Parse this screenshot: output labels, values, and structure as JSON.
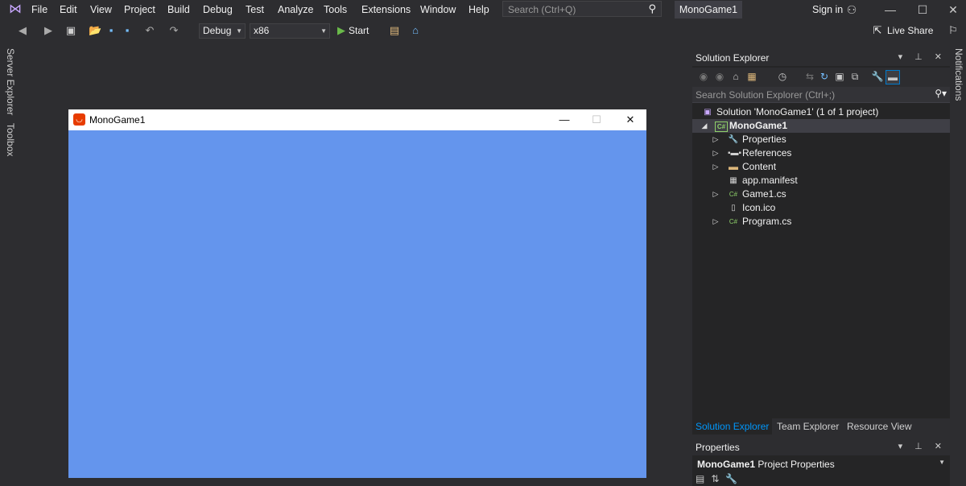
{
  "menu": [
    "File",
    "Edit",
    "View",
    "Project",
    "Build",
    "Debug",
    "Test",
    "Analyze",
    "Tools",
    "Extensions",
    "Window",
    "Help"
  ],
  "search": {
    "placeholder": "Search (Ctrl+Q)"
  },
  "solution_title": "MonoGame1",
  "sign_in": "Sign in",
  "live_share": "Live Share",
  "toolbar": {
    "configuration": "Debug",
    "platform": "x86",
    "start": "Start"
  },
  "side_tabs": {
    "server_explorer": "Server Explorer",
    "toolbox": "Toolbox",
    "notifications": "Notifications"
  },
  "game_window": {
    "title": "MonoGame1",
    "background": "#6495ed",
    "accent": "#e73c00"
  },
  "solution_explorer": {
    "title": "Solution Explorer",
    "search_placeholder": "Search Solution Explorer (Ctrl+;)",
    "tree": [
      {
        "label": "Solution 'MonoGame1' (1 of 1 project)",
        "icon": "solution-icon",
        "depth": 0,
        "expander": ""
      },
      {
        "label": "MonoGame1",
        "icon": "csharp-project-icon",
        "depth": 0,
        "expander": "◢",
        "selected": true
      },
      {
        "label": "Properties",
        "icon": "wrench-icon",
        "depth": 1,
        "expander": "▷"
      },
      {
        "label": "References",
        "icon": "references-icon",
        "depth": 1,
        "expander": "▷"
      },
      {
        "label": "Content",
        "icon": "folder-icon",
        "depth": 1,
        "expander": "▷"
      },
      {
        "label": "app.manifest",
        "icon": "manifest-icon",
        "depth": 1,
        "expander": ""
      },
      {
        "label": "Game1.cs",
        "icon": "csharp-file-icon",
        "depth": 1,
        "expander": "▷"
      },
      {
        "label": "Icon.ico",
        "icon": "file-icon",
        "depth": 1,
        "expander": ""
      },
      {
        "label": "Program.cs",
        "icon": "csharp-file-icon",
        "depth": 1,
        "expander": "▷"
      }
    ],
    "tabs": [
      "Solution Explorer",
      "Team Explorer",
      "Resource View"
    ],
    "active_tab_color": "#0097fb"
  },
  "properties": {
    "title": "Properties",
    "object": "MonoGame1",
    "object_type": "Project Properties"
  }
}
